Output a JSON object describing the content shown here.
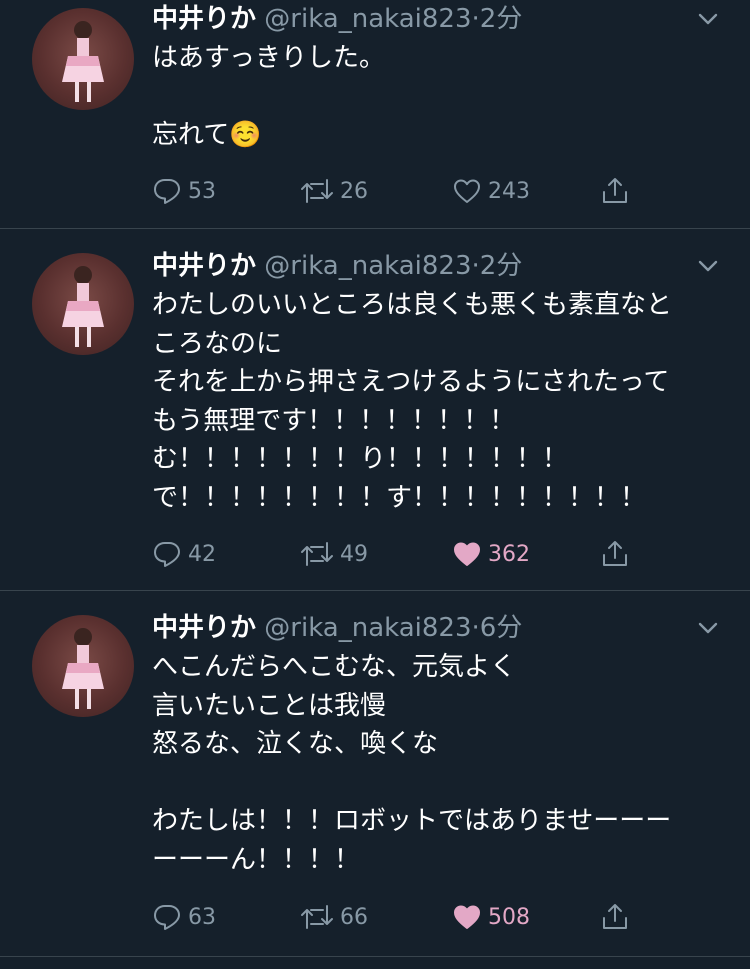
{
  "colors": {
    "background": "#15202b",
    "divider": "#38444d",
    "muted": "#8899a6",
    "like_active": "#e3a8c6"
  },
  "tweets": [
    {
      "name": "中井りか",
      "handle": "@rika_nakai823",
      "separator": "·",
      "time": "2分",
      "lines": [
        "はあすっきりした。",
        "",
        "忘れて☺️"
      ],
      "replies": "53",
      "retweets": "26",
      "likes": "243",
      "liked": false
    },
    {
      "name": "中井りか",
      "handle": "@rika_nakai823",
      "separator": "·",
      "time": "2分",
      "lines": [
        "わたしのいいところは良くも悪くも素直なと",
        "ころなのに",
        "それを上から押さえつけるようにされたって",
        "もう無理です！！！！！！！！",
        "む！！！！！！！り！！！！！！！",
        "で！！！！！！！！す！！！！！！！！！"
      ],
      "replies": "42",
      "retweets": "49",
      "likes": "362",
      "liked": true
    },
    {
      "name": "中井りか",
      "handle": "@rika_nakai823",
      "separator": "·",
      "time": "6分",
      "lines": [
        "へこんだらへこむな、元気よく",
        "言いたいことは我慢",
        "怒るな、泣くな、喚くな",
        "",
        "わたしは！！！ロボットではありませーーー",
        "ーーーん！！！！"
      ],
      "replies": "63",
      "retweets": "66",
      "likes": "508",
      "liked": true
    }
  ],
  "icons": {
    "reply": "reply-icon",
    "retweet": "retweet-icon",
    "like": "heart-icon",
    "share": "share-icon",
    "more": "chevron-down-icon",
    "avatar": "avatar"
  }
}
